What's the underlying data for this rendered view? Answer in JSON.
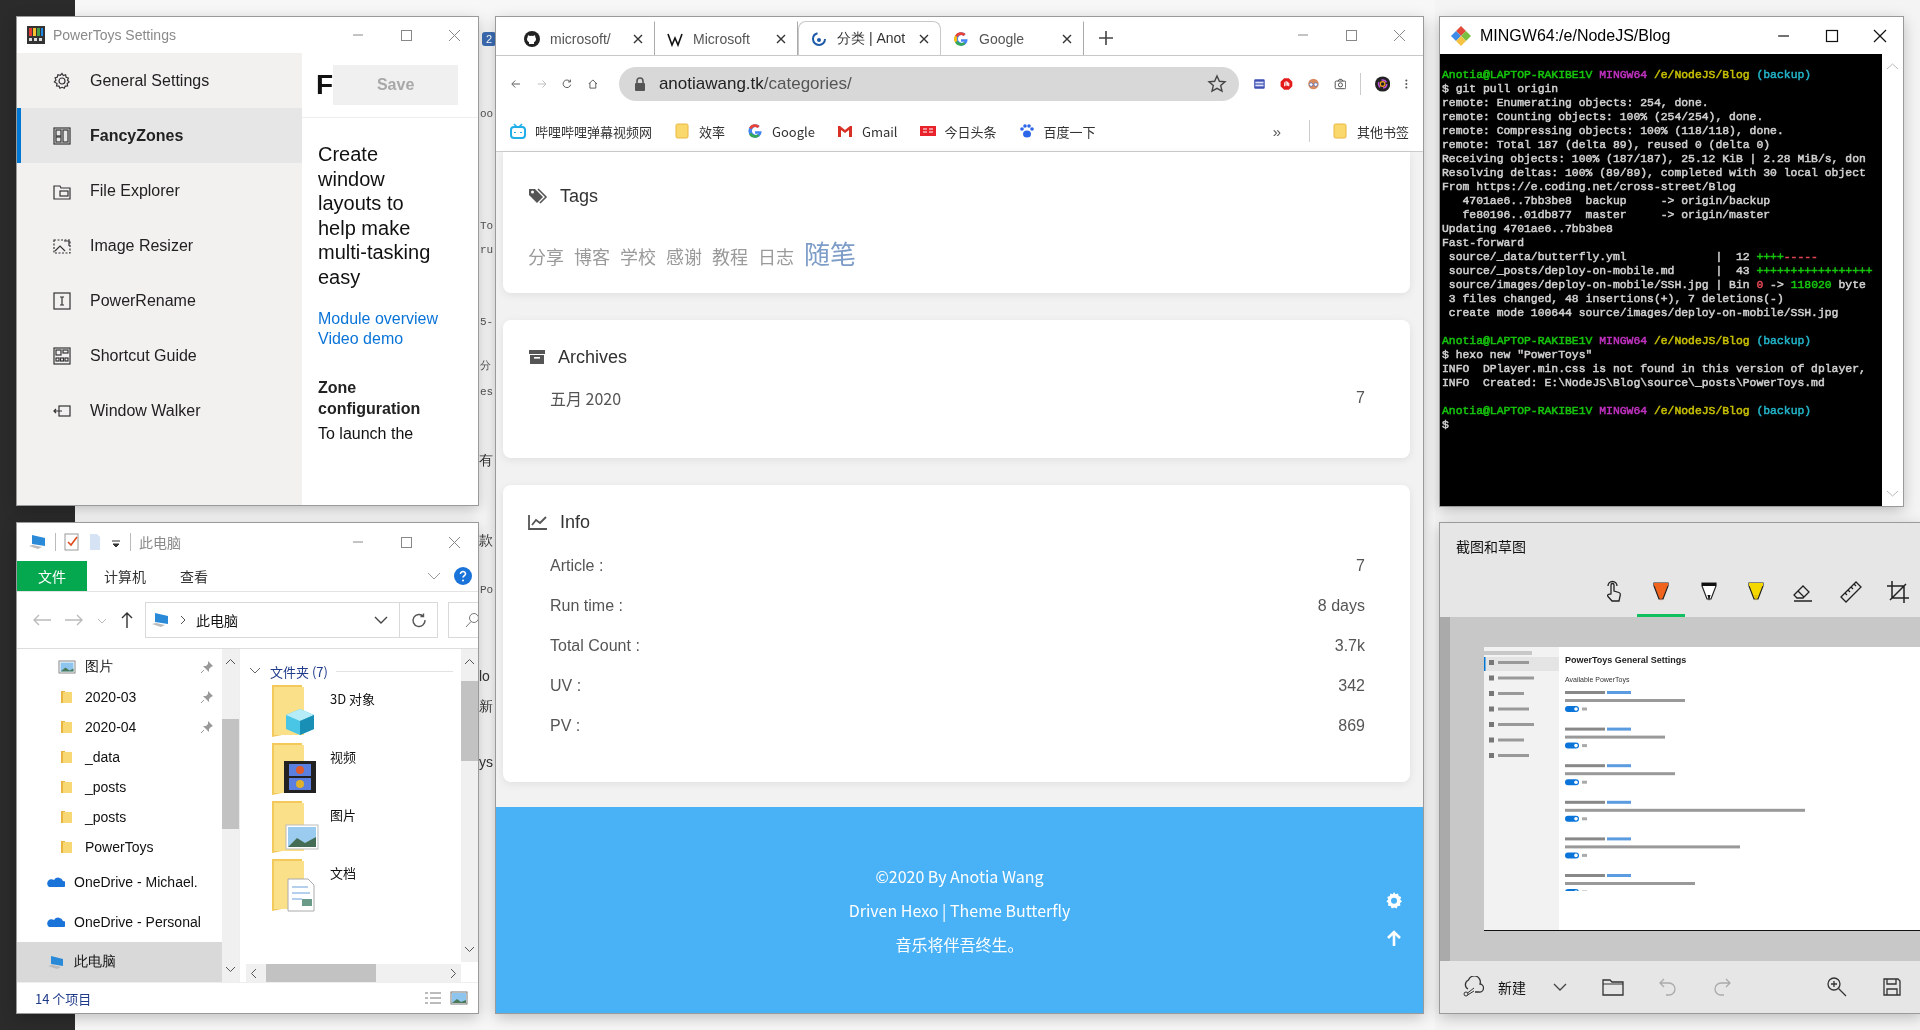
{
  "background_fragments": [
    {
      "text": "2",
      "kind": "badge"
    },
    {
      "text": "oo",
      "kind": "code"
    },
    {
      "text": "To",
      "kind": "code"
    },
    {
      "text": "ru",
      "kind": "code"
    },
    {
      "text": "5-",
      "kind": "code"
    },
    {
      "text": "分",
      "kind": "code"
    },
    {
      "text": "es",
      "kind": "code"
    },
    {
      "text": "有",
      "kind": "text"
    },
    {
      "text": "款",
      "kind": "text"
    },
    {
      "text": "Po",
      "kind": "code"
    },
    {
      "text": "lo",
      "kind": "text"
    },
    {
      "text": "新",
      "kind": "text"
    },
    {
      "text": "ys",
      "kind": "text"
    }
  ],
  "powertoys": {
    "title": "PowerToys Settings",
    "nav": [
      {
        "label": "General Settings",
        "kind": "gear",
        "selected": false
      },
      {
        "label": "FancyZones",
        "kind": "zones",
        "selected": true
      },
      {
        "label": "File Explorer",
        "kind": "explorer",
        "selected": false
      },
      {
        "label": "Image Resizer",
        "kind": "resizer",
        "selected": false
      },
      {
        "label": "PowerRename",
        "kind": "rename",
        "selected": false
      },
      {
        "label": "Shortcut Guide",
        "kind": "shortcut",
        "selected": false
      },
      {
        "label": "Window Walker",
        "kind": "walker",
        "selected": false
      }
    ],
    "header": "F",
    "save_button": {
      "label": "Save",
      "disabled": true
    },
    "description": "Create window layouts to help make multi-tasking easy",
    "links": [
      "Module overview",
      "Video demo"
    ],
    "section_title": "Zone configuration",
    "section_text": "To launch the"
  },
  "explorer": {
    "title": "此电脑",
    "ribbon_tabs": [
      {
        "label": "文件",
        "selected": true
      },
      {
        "label": "计算机",
        "selected": false
      },
      {
        "label": "查看",
        "selected": false
      }
    ],
    "address": "此电脑",
    "nav": [
      {
        "label": "图片",
        "kind": "pictures",
        "pinned": true,
        "selected": false
      },
      {
        "label": "2020-03",
        "kind": "folder",
        "pinned": true,
        "selected": false
      },
      {
        "label": "2020-04",
        "kind": "folder",
        "pinned": true,
        "selected": false
      },
      {
        "label": "_data",
        "kind": "folder",
        "pinned": false,
        "selected": false
      },
      {
        "label": "_posts",
        "kind": "folder",
        "pinned": false,
        "selected": false
      },
      {
        "label": "_posts",
        "kind": "folder",
        "pinned": false,
        "selected": false
      },
      {
        "label": "PowerToys",
        "kind": "folder",
        "pinned": false,
        "selected": false
      },
      {
        "label": "OneDrive - Michael.",
        "kind": "cloud",
        "pinned": false,
        "selected": false
      },
      {
        "label": "OneDrive - Personal",
        "kind": "cloud",
        "pinned": false,
        "selected": false
      },
      {
        "label": "此电脑",
        "kind": "pc",
        "pinned": false,
        "selected": true
      }
    ],
    "group": "文件夹 (7)",
    "items": [
      {
        "label": "3D 对象",
        "kind": "cube"
      },
      {
        "label": "视频",
        "kind": "video"
      },
      {
        "label": "图片",
        "kind": "pictures"
      },
      {
        "label": "文档",
        "kind": "documents"
      }
    ],
    "status": "14 个项目"
  },
  "browser": {
    "tabs": [
      {
        "title": "microsoft/",
        "kind": "github",
        "selected": false
      },
      {
        "title": "Microsoft",
        "kind": "wikipedia",
        "selected": false
      },
      {
        "title": "分类 | Anot",
        "kind": "site",
        "selected": true
      },
      {
        "title": "Google",
        "kind": "google",
        "selected": false
      }
    ],
    "url_host": "anotiawang.tk",
    "url_path": "/categories/",
    "bookmarks": [
      {
        "label": "哔哩哔哩弹幕视频网",
        "kind": "tv"
      },
      {
        "label": "效率",
        "kind": "folder"
      },
      {
        "label": "Google",
        "kind": "google"
      },
      {
        "label": "Gmail",
        "kind": "gmail"
      },
      {
        "label": "今日头条",
        "kind": "news"
      },
      {
        "label": "百度一下",
        "kind": "paw"
      }
    ],
    "overflow": "»",
    "other_bookmarks": "其他书签",
    "tags_card": {
      "title": "Tags",
      "tags": [
        {
          "label": "分享",
          "highlighted": false
        },
        {
          "label": "博客",
          "highlighted": false
        },
        {
          "label": "学校",
          "highlighted": false
        },
        {
          "label": "感谢",
          "highlighted": false
        },
        {
          "label": "教程",
          "highlighted": false
        },
        {
          "label": "日志",
          "highlighted": false
        },
        {
          "label": "随笔",
          "highlighted": true
        }
      ]
    },
    "archives_card": {
      "title": "Archives",
      "rows": [
        {
          "label": "五月 2020",
          "count": "7"
        }
      ]
    },
    "info_card": {
      "title": "Info",
      "rows": [
        {
          "label": "Article :",
          "value": "7"
        },
        {
          "label": "Run time :",
          "value": "8 days"
        },
        {
          "label": "Total Count :",
          "value": "3.7k"
        },
        {
          "label": "UV :",
          "value": "342"
        },
        {
          "label": "PV :",
          "value": "869"
        }
      ]
    },
    "footer": [
      "©2020 By Anotia Wang",
      "Driven Hexo | Theme Butterfly",
      "音乐将伴吾终生。"
    ]
  },
  "terminal": {
    "title": "MINGW64:/e/NodeJS/Blog",
    "blocks": [
      [
        [
          {
            "text": "Anotia@LAPTOP-RAKIBE1V ",
            "color": "#16c60c"
          },
          {
            "text": "MINGW64 ",
            "color": "#c032c0"
          },
          {
            "text": "/e/NodeJS/Blog ",
            "color": "#c8c000"
          },
          {
            "text": "(backup)",
            "color": "#22b4c8"
          }
        ],
        [
          {
            "text": "$ git pull origin",
            "color": "#d0d0d0"
          }
        ],
        [
          {
            "text": "remote: Enumerating objects: 254, done.",
            "color": "#d0d0d0"
          }
        ],
        [
          {
            "text": "remote: Counting objects: 100% (254/254), done.",
            "color": "#d0d0d0"
          }
        ],
        [
          {
            "text": "remote: Compressing objects: 100% (118/118), done.",
            "color": "#d0d0d0"
          }
        ],
        [
          {
            "text": "remote: Total 187 (delta 89), reused 0 (delta 0)",
            "color": "#d0d0d0"
          }
        ],
        [
          {
            "text": "Receiving objects: 100% (187/187), 25.12 KiB | 2.28 MiB/s, don",
            "color": "#d0d0d0"
          }
        ],
        [
          {
            "text": "Resolving deltas: 100% (89/89), completed with 30 local object",
            "color": "#d0d0d0"
          }
        ],
        [
          {
            "text": "From https://e.coding.net/cross-street/Blog",
            "color": "#d0d0d0"
          }
        ],
        [
          {
            "text": "   4701ae6..7bb3be8  backup     -> origin/backup",
            "color": "#d0d0d0"
          }
        ],
        [
          {
            "text": "   fe80196..01db877  master     -> origin/master",
            "color": "#d0d0d0"
          }
        ],
        [
          {
            "text": "Updating 4701ae6..7bb3be8",
            "color": "#d0d0d0"
          }
        ],
        [
          {
            "text": "Fast-forward",
            "color": "#d0d0d0"
          }
        ],
        [
          {
            "text": " source/_data/butterfly.yml             |  12 ",
            "color": "#d0d0d0"
          },
          {
            "text": "++++",
            "color": "#16c60c"
          },
          {
            "text": "-----",
            "color": "#e74856"
          }
        ],
        [
          {
            "text": " source/_posts/deploy-on-mobile.md      |  43 ",
            "color": "#d0d0d0"
          },
          {
            "text": "+++++++++++++++++",
            "color": "#16c60c"
          }
        ],
        [
          {
            "text": " source/images/deploy-on-mobile/SSH.jpg | Bin ",
            "color": "#d0d0d0"
          },
          {
            "text": "0",
            "color": "#e74856"
          },
          {
            "text": " -> ",
            "color": "#d0d0d0"
          },
          {
            "text": "118020",
            "color": "#16c60c"
          },
          {
            "text": " byte",
            "color": "#d0d0d0"
          }
        ],
        [
          {
            "text": " 3 files changed, 48 insertions(+), 7 deletions(-)",
            "color": "#d0d0d0"
          }
        ],
        [
          {
            "text": " create mode 100644 source/images/deploy-on-mobile/SSH.jpg",
            "color": "#d0d0d0"
          }
        ]
      ],
      [
        [
          {
            "text": "Anotia@LAPTOP-RAKIBE1V ",
            "color": "#16c60c"
          },
          {
            "text": "MINGW64 ",
            "color": "#c032c0"
          },
          {
            "text": "/e/NodeJS/Blog ",
            "color": "#c8c000"
          },
          {
            "text": "(backup)",
            "color": "#22b4c8"
          }
        ],
        [
          {
            "text": "$ hexo new \"PowerToys\"",
            "color": "#d0d0d0"
          }
        ],
        [
          {
            "text": "INFO  DPlayer.min.css is not found in this version of dplayer,",
            "color": "#d0d0d0"
          }
        ],
        [
          {
            "text": "INFO  Created: E:\\NodeJS\\Blog\\source\\_posts\\PowerToys.md",
            "color": "#d0d0d0"
          }
        ]
      ],
      [
        [
          {
            "text": "Anotia@LAPTOP-RAKIBE1V ",
            "color": "#16c60c"
          },
          {
            "text": "MINGW64 ",
            "color": "#c032c0"
          },
          {
            "text": "/e/NodeJS/Blog ",
            "color": "#c8c000"
          },
          {
            "text": "(backup)",
            "color": "#22b4c8"
          }
        ],
        [
          {
            "text": "$",
            "color": "#d0d0d0"
          }
        ]
      ]
    ]
  },
  "snip": {
    "title": "截图和草图",
    "tools": [
      {
        "kind": "touch",
        "selected": false
      },
      {
        "kind": "ballpoint",
        "selected": true
      },
      {
        "kind": "pencil",
        "selected": false
      },
      {
        "kind": "highlighter",
        "selected": false
      },
      {
        "kind": "eraser",
        "selected": false
      },
      {
        "kind": "ruler",
        "selected": false
      },
      {
        "kind": "crop",
        "selected": false
      }
    ],
    "new_label": "新建",
    "preview": {
      "title": "PowerToys General Settings",
      "subtitle": "Available PowerToys"
    }
  }
}
